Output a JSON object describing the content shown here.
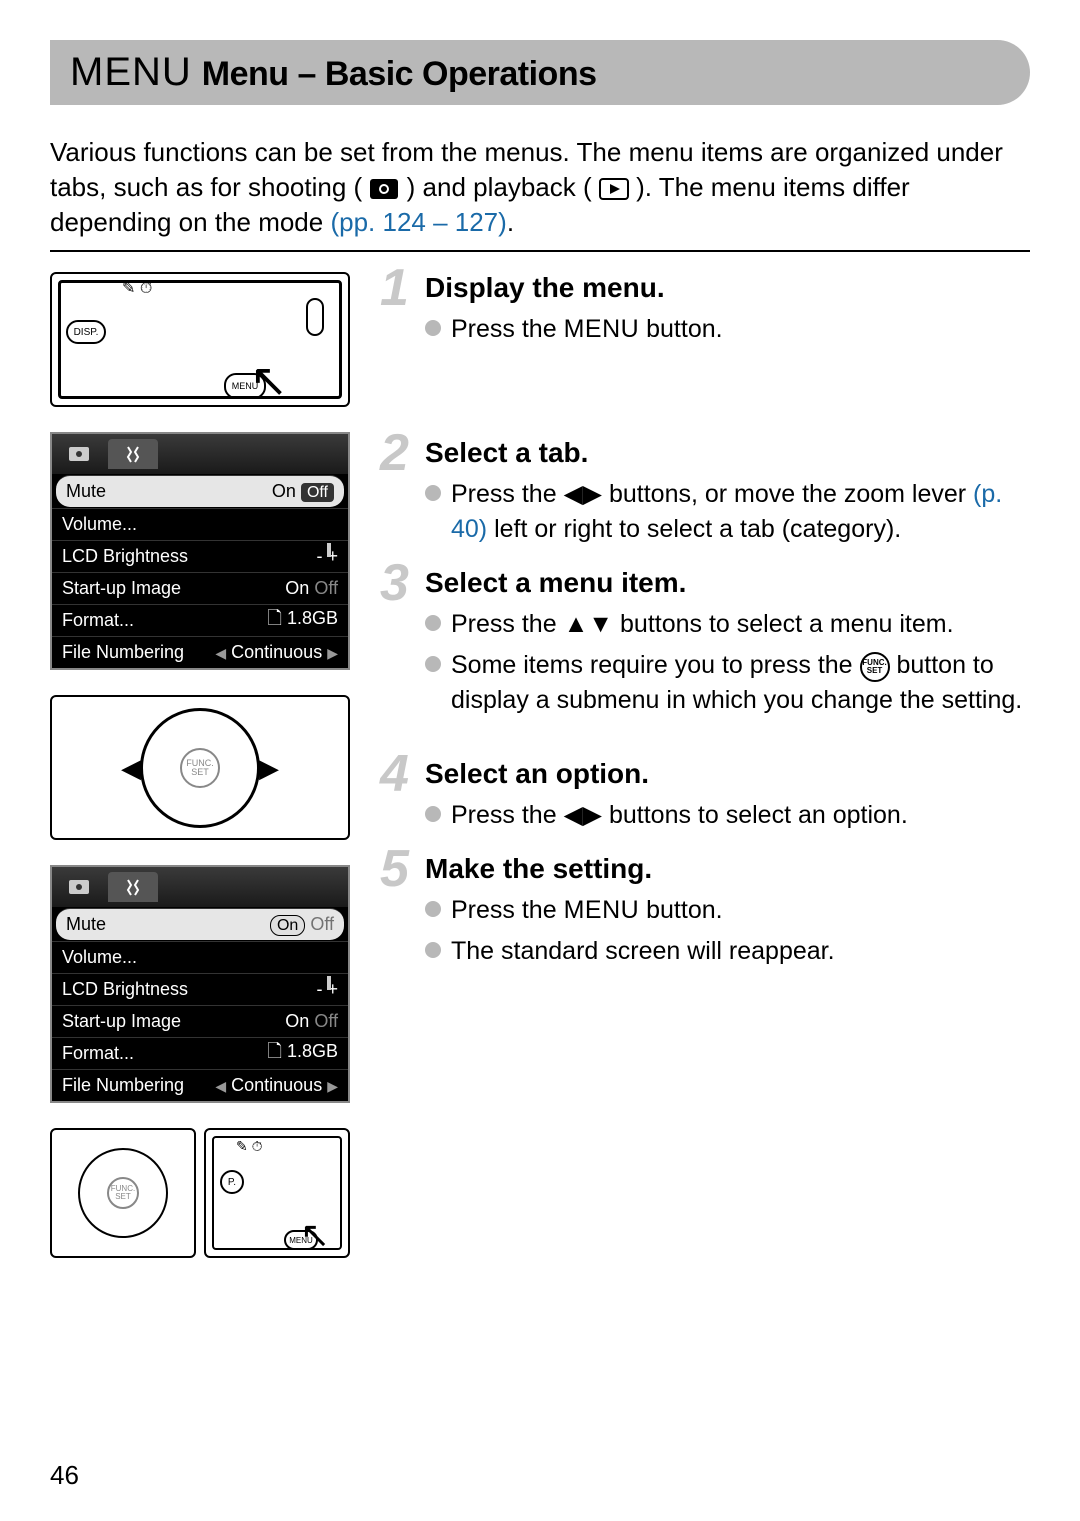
{
  "title": {
    "lead": "MENU",
    "rest": "Menu – Basic Operations"
  },
  "intro": {
    "line1": "Various functions can be set from the menus. The menu items are organized under tabs, such as for shooting (",
    "line2": ") and playback (",
    "line3": "). The menu items differ depending on the mode ",
    "link": "(pp. 124 – 127)",
    "end": "."
  },
  "steps": [
    {
      "num": "1",
      "title": "Display the menu.",
      "items": [
        {
          "before": "Press the ",
          "sym": "MENU",
          "after": " button."
        }
      ]
    },
    {
      "num": "2",
      "title": "Select a tab.",
      "items": [
        {
          "before": "Press the ",
          "sym": "lr",
          "after": " buttons, or move the zoom lever ",
          "link": "(p. 40)",
          "after2": " left or right to select a tab (category)."
        }
      ]
    },
    {
      "num": "3",
      "title": "Select a menu item.",
      "items": [
        {
          "before": "Press the ",
          "sym": "ud",
          "after": " buttons to select a menu item."
        },
        {
          "before": "Some items require you to press the ",
          "sym": "func",
          "after": " button to display a submenu in which you change the setting."
        }
      ]
    },
    {
      "num": "4",
      "title": "Select an option.",
      "items": [
        {
          "before": "Press the ",
          "sym": "lr",
          "after": " buttons to select an option."
        }
      ]
    },
    {
      "num": "5",
      "title": "Make the setting.",
      "items": [
        {
          "before": "Press the ",
          "sym": "MENU",
          "after": " button."
        },
        {
          "before": "The standard screen will reappear."
        }
      ]
    }
  ],
  "camera": {
    "disp": "DISP.",
    "menu": "MENU"
  },
  "screen": {
    "rows": [
      {
        "label": "Mute",
        "value": "On",
        "off": "Off"
      },
      {
        "label": "Volume..."
      },
      {
        "label": "LCD Brightness",
        "slider": true
      },
      {
        "label": "Start-up Image",
        "value": "On",
        "dim": "Off"
      },
      {
        "label": "Format...",
        "value": "1.8GB"
      },
      {
        "label": "File Numbering",
        "value": "Continuous",
        "arrows": true
      }
    ]
  },
  "screen2_sel_on": "On",
  "screen2_sel_off": "Off",
  "wheel": {
    "func": "FUNC.",
    "set": "SET"
  },
  "pageNum": "46"
}
